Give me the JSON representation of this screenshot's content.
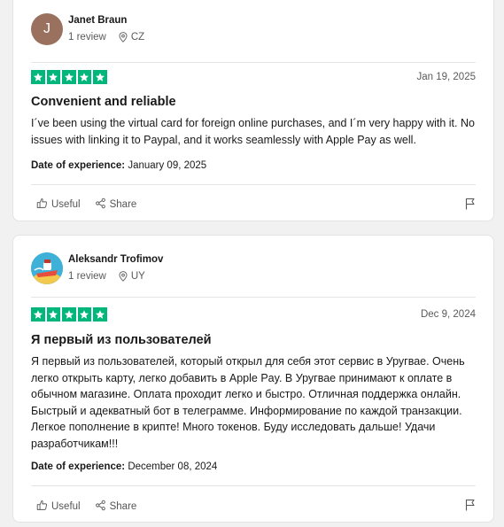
{
  "reviews": [
    {
      "avatar_letter": "J",
      "name": "Janet Braun",
      "review_count": "1 review",
      "country": "CZ",
      "rating": 5,
      "date": "Jan 19, 2025",
      "title": "Convenient and reliable",
      "body": "I´ve been using the virtual card for foreign online purchases, and I´m very happy with it. No issues with linking it to Paypal, and it works seamlessly with Apple Pay as well.",
      "experience_label": "Date of experience:",
      "experience_date": "January 09, 2025",
      "useful_label": "Useful",
      "share_label": "Share"
    },
    {
      "name": "Aleksandr Trofimov",
      "review_count": "1 review",
      "country": "UY",
      "rating": 5,
      "date": "Dec 9, 2024",
      "title": "Я первый из пользователей",
      "body": "Я первый из пользователей, который открыл для себя этот сервис в Уругвае. Очень легко открыть карту, легко добавить в Apple Pay. В Уругвае принимают к оплате в обычном магазине. Оплата проходит легко и быстро. Отличная поддержка онлайн. Быстрый и адекватный бот в телеграмме. Информирование по каждой транзакции. Легкое пополнение в крипте! Много токенов. Буду исследовать дальше! Удачи разработчикам!!!",
      "experience_label": "Date of experience:",
      "experience_date": "December 08, 2024",
      "useful_label": "Useful",
      "share_label": "Share"
    }
  ],
  "colors": {
    "star_green": "#00b67a",
    "avatar_brown": "#9a705e",
    "avatar_blue": "#3fb1d9"
  },
  "icons": [
    "location-pin-icon",
    "star-icon",
    "thumbs-up-icon",
    "share-icon",
    "flag-icon"
  ]
}
